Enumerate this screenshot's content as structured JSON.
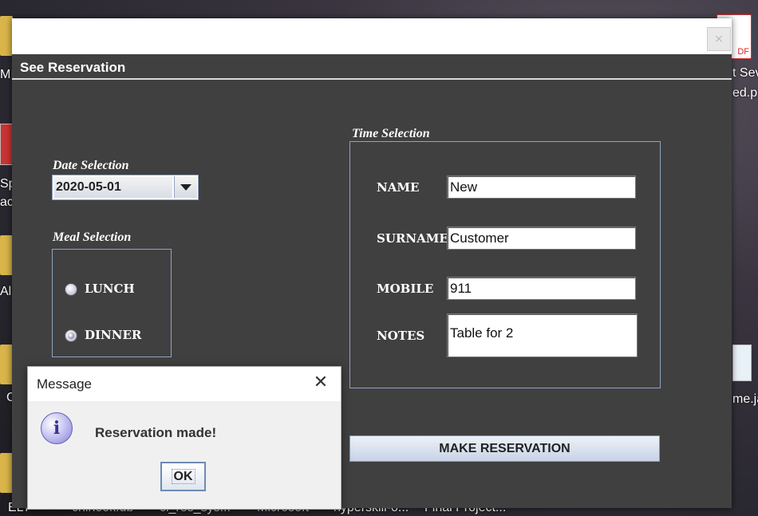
{
  "desktop": {
    "icon_labels": [
      "MIS",
      "Sp",
      "ac",
      "Ala",
      "Cl",
      "ELT",
      "chinook.db",
      "cl_res_sys...",
      "Microsoft",
      "hyperskill-o...",
      "Final Project...",
      "t Seve",
      "ed.p",
      "me.ja"
    ],
    "pdf_badge": "DF"
  },
  "window": {
    "close_glyph": "×",
    "panel_title": "See Reservation",
    "date_section": {
      "label": "Date Selection",
      "selected_date": "2020-05-01"
    },
    "meal_section": {
      "label": "Meal Selection",
      "options": [
        {
          "label": "LUNCH",
          "selected": false
        },
        {
          "label": "DINNER",
          "selected": true
        }
      ]
    },
    "time_section": {
      "label": "Time Selection",
      "fields": {
        "name": {
          "label": "NAME",
          "value": "New"
        },
        "surname": {
          "label": "SURNAME",
          "value": "Customer"
        },
        "mobile": {
          "label": "MOBILE",
          "value": "911"
        },
        "notes": {
          "label": "NOTES",
          "value": "Table for 2"
        }
      }
    },
    "make_reservation_label": "MAKE RESERVATION"
  },
  "dialog": {
    "title": "Message",
    "close_glyph": "✕",
    "icon": "info-icon",
    "icon_glyph": "i",
    "message": "Reservation made!",
    "ok_label": "OK"
  }
}
